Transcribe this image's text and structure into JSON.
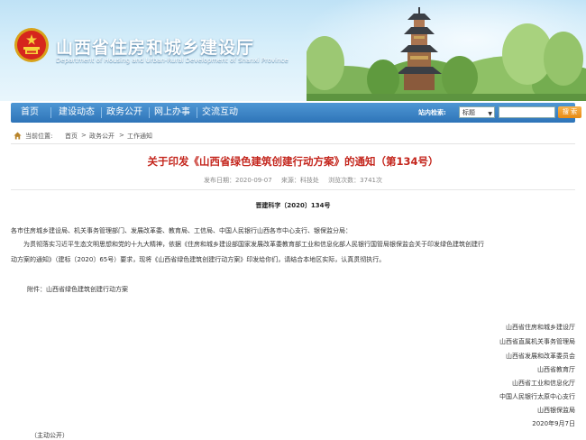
{
  "header": {
    "site_title": "山西省住房和城乡建设厅",
    "site_subtitle": "Department of Housing and Urban-Rural Development of Shanxi Province"
  },
  "nav": {
    "items": [
      "首页",
      "建设动态",
      "政务公开",
      "网上办事",
      "交流互动"
    ],
    "search_label": "站内检索:",
    "search_select_value": "标题",
    "search_button": "搜 索"
  },
  "breadcrumb": {
    "current_label": "当前位置:",
    "items": [
      "首页",
      "政务公开",
      "工作通知"
    ],
    "separator": ">"
  },
  "article": {
    "title": "关于印发《山西省绿色建筑创建行动方案》的通知（第134号）",
    "publish_date": "发布日期：2020-09-07",
    "source": "来源：科技处",
    "views": "浏览次数：3741次",
    "doc_number": "晋建科字〔2020〕134号",
    "recipients": "各市住房城乡建设局、机关事务管理部门、发展改革委、教育局、工信局、中国人民银行山西各市中心支行、银保监分局：",
    "para1_line1": "为贯彻落实习近平生态文明思想和党的十九大精神，依据《住房和城乡建设部国家发展改革委教育部工业和信息化部人民银行国管局银保监会关于印发绿色建筑创建行",
    "para1_line2": "动方案的通知》（建标〔2020〕65号）要求，现将《山西省绿色建筑创建行动方案》印发给你们，请结合本地区实际，认真贯彻执行。",
    "attachment": "附件：山西省绿色建筑创建行动方案",
    "signatories": [
      "山西省住房和城乡建设厅",
      "山西省直属机关事务管理局",
      "山西省发展和改革委员会",
      "山西省教育厅",
      "山西省工业和信息化厅",
      "中国人民银行太原中心支行",
      "山西银保监局",
      "2020年9月7日"
    ],
    "disclosure": "（主动公开）"
  },
  "colors": {
    "nav_blue": "#2e74b8",
    "title_red": "#c4261d",
    "search_orange": "#e78a14"
  }
}
